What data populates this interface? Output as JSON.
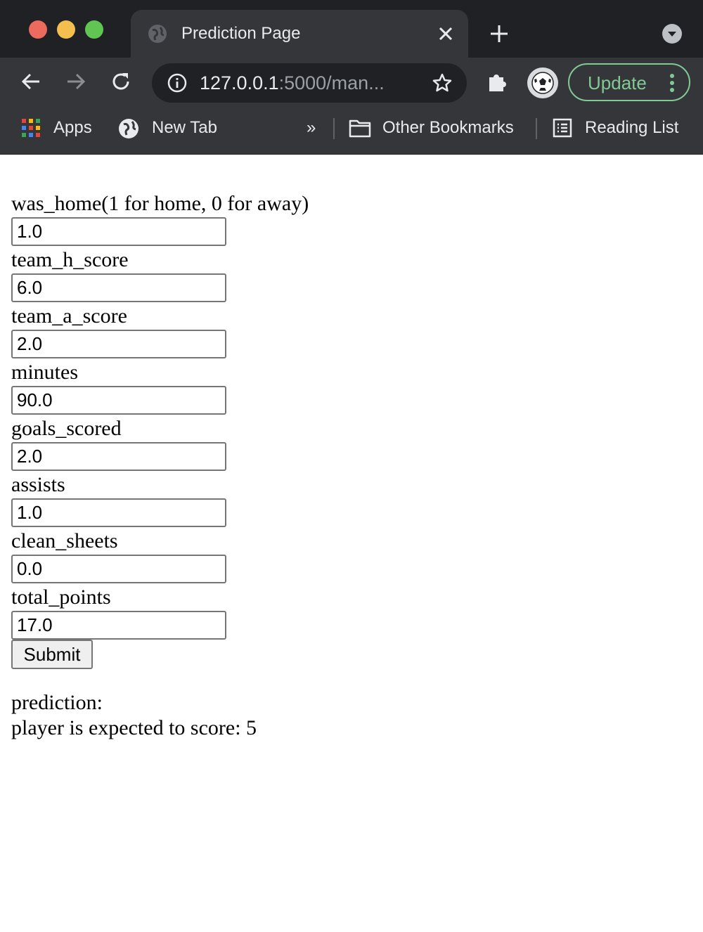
{
  "browser": {
    "tab_title": "Prediction Page",
    "url_host": "127.0.0.1",
    "url_rest": ":5000/man...",
    "update_label": "Update",
    "bookmarks": {
      "apps": "Apps",
      "new_tab": "New Tab",
      "overflow": "»",
      "other": "Other Bookmarks",
      "reading_list": "Reading List"
    }
  },
  "form": {
    "fields": [
      {
        "label": "was_home(1 for home, 0 for away)",
        "value": "1.0"
      },
      {
        "label": "team_h_score",
        "value": "6.0"
      },
      {
        "label": "team_a_score",
        "value": "2.0"
      },
      {
        "label": "minutes",
        "value": "90.0"
      },
      {
        "label": "goals_scored",
        "value": "2.0"
      },
      {
        "label": "assists",
        "value": "1.0"
      },
      {
        "label": "clean_sheets",
        "value": "0.0"
      },
      {
        "label": "total_points",
        "value": "17.0"
      }
    ],
    "submit_label": "Submit"
  },
  "result": {
    "heading": "prediction:",
    "text": "player is expected to score: 5"
  }
}
